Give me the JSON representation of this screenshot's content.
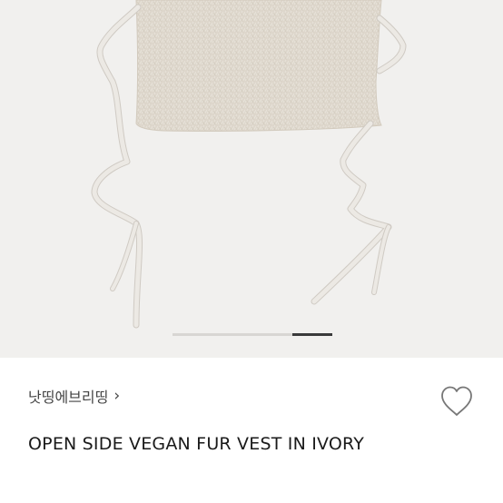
{
  "product": {
    "image_alt": "OPEN SIDE VEGAN FUR VEST IN IVORY",
    "carousel_progress": 0.25,
    "brand": "낫띵에브리띵",
    "brand_chevron": "›",
    "title": "OPEN SIDE VEGAN FUR VEST IN IVORY",
    "wishlist_icon": "heart-outline-icon"
  },
  "colors": {
    "image_bg": "#f1f0ee",
    "fur": "#ddd6cb",
    "tie": "#e9e6e1",
    "tie_edge": "#cfcac3",
    "carousel_active": "#3a3a3a",
    "carousel_track": "#d8d6d3",
    "text": "#1a1a1a"
  }
}
